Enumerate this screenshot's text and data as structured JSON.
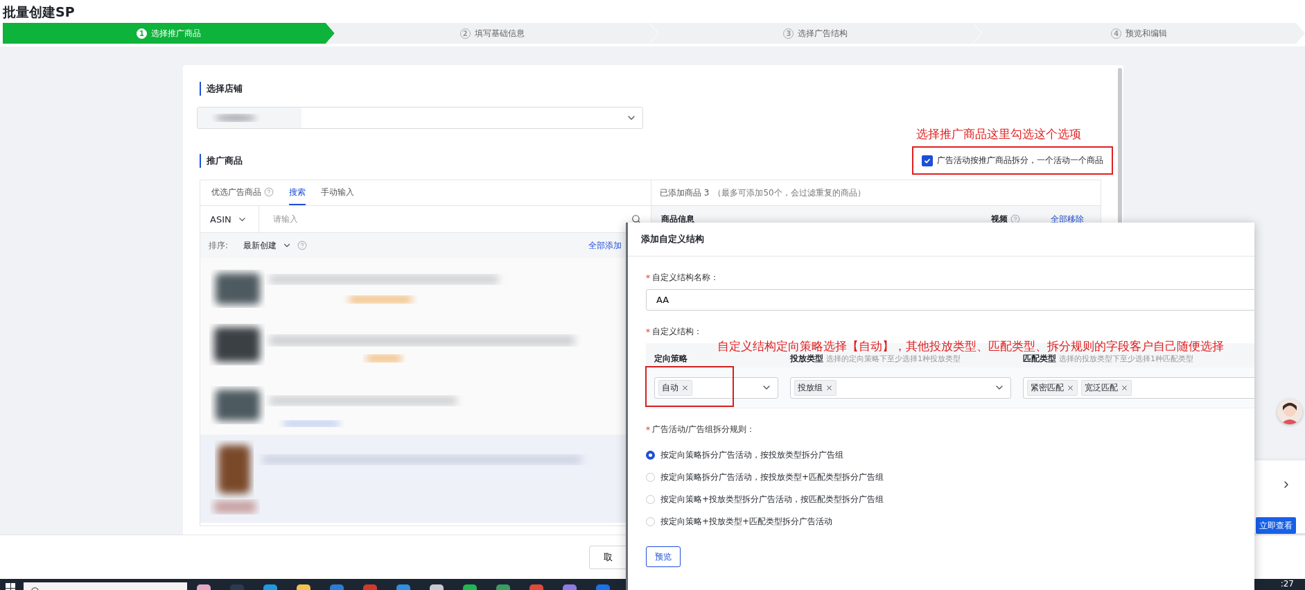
{
  "page_title": "批量创建SP",
  "steps": [
    {
      "number": "1",
      "label": "选择推广商品",
      "selected": true
    },
    {
      "number": "2",
      "label": "填写基础信息",
      "selected": false
    },
    {
      "number": "3",
      "label": "选择广告结构",
      "selected": false
    },
    {
      "number": "4",
      "label": "预览和编辑",
      "selected": false
    }
  ],
  "store_section": {
    "heading": "选择店铺"
  },
  "product_section": {
    "heading": "推广商品",
    "annotation": "选择推广商品这里勾选这个选项",
    "split_option": {
      "label": "广告活动按推广商品拆分，一个活动一个商品",
      "checked": true
    },
    "source_tabs": [
      {
        "label": "优选广告商品",
        "kind": "help",
        "selected": false
      },
      {
        "label": "搜索",
        "kind": "plain",
        "selected": true
      },
      {
        "label": "手动输入",
        "kind": "plain",
        "selected": false
      }
    ],
    "search": {
      "field_type": "ASIN",
      "placeholder": "请输入"
    },
    "sort": {
      "label": "排序:",
      "value": "最新创建",
      "add_all": "全部添加"
    },
    "added": {
      "title": "已添加商品 3",
      "note": "（最多可添加50个，会过滤重复的商品）",
      "columns": [
        {
          "title": "商品信息",
          "kind": "plain"
        },
        {
          "title": "视频",
          "kind": "help"
        }
      ],
      "remove_all": "全部移除"
    }
  },
  "footer": {
    "cancel_button": "取"
  },
  "modal": {
    "title": "添加自定义结构",
    "name_field": {
      "mark": "*",
      "label": "自定义结构名称：",
      "value": "AA"
    },
    "structure": {
      "mark": "*",
      "label": "自定义结构：",
      "annotation": "自定义结构定向策略选择【自动】，其他投放类型、匹配类型、拆分规则的字段客户自己随便选择",
      "columns": [
        {
          "title": "定向策略",
          "tags": [
            "自动"
          ],
          "highlighted": true
        },
        {
          "title": "投放类型",
          "hint": "选择的定向策略下至少选择1种投放类型",
          "tags": [
            "投放组"
          ],
          "highlighted": false
        },
        {
          "title": "匹配类型",
          "hint": "选择的投放类型下至少选择1种匹配类型",
          "tags": [
            "紧密匹配",
            "宽泛匹配"
          ],
          "highlighted": false
        }
      ]
    },
    "split_rule": {
      "mark": "*",
      "label": "广告活动/广告组拆分规则：",
      "options": [
        {
          "label": "按定向策略拆分广告活动，按投放类型拆分广告组",
          "selected": true
        },
        {
          "label": "按定向策略拆分广告活动，按投放类型+匹配类型拆分广告组",
          "selected": false
        },
        {
          "label": "按定向策略+投放类型拆分广告活动，按匹配类型拆分广告组",
          "selected": false
        },
        {
          "label": "按定向策略+投放类型+匹配类型拆分广告活动",
          "selected": false
        }
      ]
    },
    "preview_button": "预览"
  },
  "side_panel": {
    "button": "立即查看"
  },
  "taskbar": {
    "clock": ":27"
  }
}
